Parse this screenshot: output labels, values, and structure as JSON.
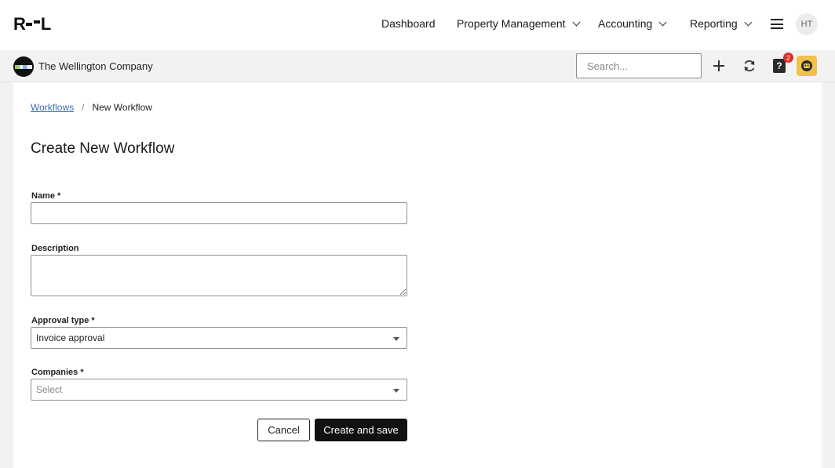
{
  "header": {
    "logo_text": "R--L",
    "nav": [
      {
        "label": "Dashboard"
      },
      {
        "label": "Property Management"
      },
      {
        "label": "Accounting"
      },
      {
        "label": "Reporting"
      }
    ],
    "user_initials": "HT"
  },
  "subbar": {
    "company_name": "The Wellington Company",
    "search_placeholder": "Search...",
    "help_badge_count": "2",
    "help_icon_glyph": "?"
  },
  "breadcrumb": {
    "parent": "Workflows",
    "separator": "/",
    "current": "New Workflow"
  },
  "page": {
    "title": "Create New Workflow"
  },
  "form": {
    "name": {
      "label": "Name *",
      "value": ""
    },
    "description": {
      "label": "Description",
      "value": ""
    },
    "approval_type": {
      "label": "Approval type *",
      "value": "Invoice approval"
    },
    "companies": {
      "label": "Companies *",
      "placeholder": "Select"
    },
    "cancel_label": "Cancel",
    "save_label": "Create and save"
  },
  "colors": {
    "link": "#3b6fb6",
    "badge": "#d93025",
    "assistant": "#f0c24b",
    "primary_button": "#111111"
  },
  "icons": [
    "chevron-down-icon",
    "menu-icon",
    "plus-icon",
    "refresh-icon",
    "help-icon",
    "assistant-icon",
    "dropdown-caret-icon"
  ]
}
